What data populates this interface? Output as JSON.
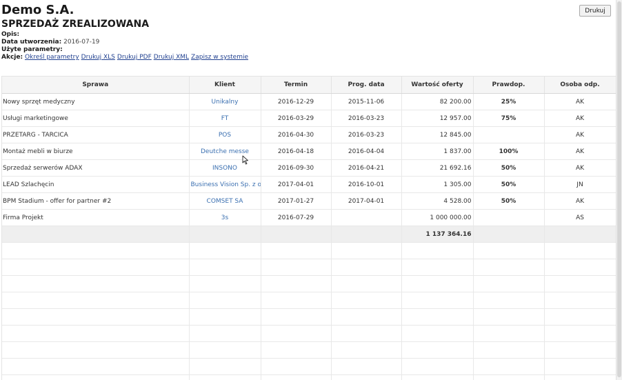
{
  "header": {
    "company": "Demo S.A.",
    "report_title": "SPRZEDAŻ ZREALIZOWANA",
    "description_label": "Opis:",
    "created_label": "Data utworzenia:",
    "created_value": "2016-07-19",
    "params_label": "Użyte parametry:",
    "actions_label": "Akcje:",
    "actions": [
      "Określ parametry",
      "Drukuj XLS",
      "Drukuj PDF",
      "Drukuj XML",
      "Zapisz w systemie"
    ]
  },
  "toolbar": {
    "print_label": "Drukuj"
  },
  "table": {
    "columns": [
      "Sprawa",
      "Klient",
      "Termin",
      "Prog. data",
      "Wartość oferty",
      "Prawdop.",
      "Osoba odp."
    ],
    "rows": [
      [
        "Nowy sprzęt medyczny",
        "Unikalny",
        "2016-12-29",
        "2015-11-06",
        "82 200.00",
        "25%",
        "AK"
      ],
      [
        "Usługi marketingowe",
        "FT",
        "2016-03-29",
        "2016-03-23",
        "12 957.00",
        "75%",
        "AK"
      ],
      [
        "PRZETARG - TARCICA",
        "POS",
        "2016-04-30",
        "2016-03-23",
        "12 845.00",
        "",
        "AK"
      ],
      [
        "Montaż mebli w biurze",
        "Deutche messe",
        "2016-04-18",
        "2016-04-04",
        "1 837.00",
        "100%",
        "AK"
      ],
      [
        "Sprzedaż serwerów ADAX",
        "INSONO",
        "2016-09-30",
        "2016-04-21",
        "21 692.16",
        "50%",
        "AK"
      ],
      [
        "LEAD Szlachęcin",
        "Business Vision Sp. z o.o.",
        "2017-04-01",
        "2016-10-01",
        "1 305.00",
        "50%",
        "JN"
      ],
      [
        "BPM Stadium - offer for partner #2",
        "COMSET SA",
        "2017-01-27",
        "2017-04-01",
        "4 528.00",
        "50%",
        "AK"
      ],
      [
        "Firma Projekt",
        "3s",
        "2016-07-29",
        "",
        "1 000 000.00",
        "",
        "AS"
      ]
    ],
    "total": "1 137 364.16"
  }
}
